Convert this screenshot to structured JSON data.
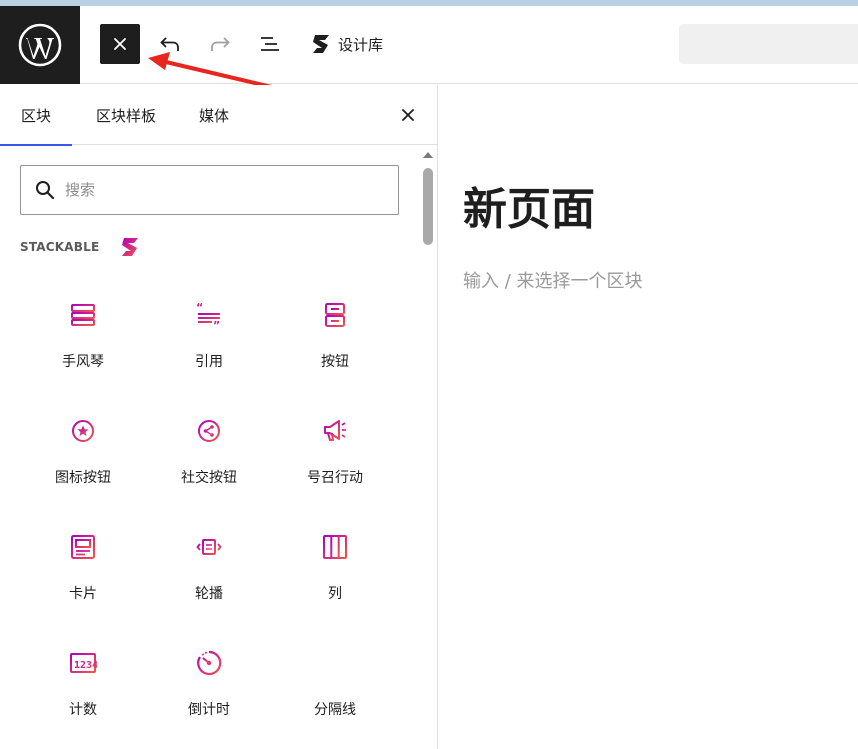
{
  "topbar": {
    "design_library_label": "设计库"
  },
  "panel": {
    "tabs": [
      {
        "label": "区块",
        "active": true
      },
      {
        "label": "区块样板",
        "active": false
      },
      {
        "label": "媒体",
        "active": false
      }
    ],
    "search_placeholder": "搜索",
    "category_label": "STACKABLE",
    "blocks": [
      {
        "label": "手风琴",
        "icon": "accordion-icon"
      },
      {
        "label": "引用",
        "icon": "blockquote-icon"
      },
      {
        "label": "按钮",
        "icon": "button-icon"
      },
      {
        "label": "图标按钮",
        "icon": "icon-button-icon"
      },
      {
        "label": "社交按钮",
        "icon": "social-buttons-icon"
      },
      {
        "label": "号召行动",
        "icon": "call-to-action-icon"
      },
      {
        "label": "卡片",
        "icon": "card-icon"
      },
      {
        "label": "轮播",
        "icon": "carousel-icon"
      },
      {
        "label": "列",
        "icon": "columns-icon"
      },
      {
        "label": "计数",
        "icon": "count-up-icon"
      },
      {
        "label": "倒计时",
        "icon": "countdown-icon"
      },
      {
        "label": "分隔线",
        "icon": "divider-icon"
      }
    ]
  },
  "canvas": {
    "title": "新页面",
    "placeholder": "输入 / 来选择一个区块"
  },
  "colors": {
    "accent": "#3858e9",
    "stackable_gradient_start": "#b300be",
    "stackable_gradient_end": "#f15449",
    "annotation_arrow": "#e8261e"
  }
}
